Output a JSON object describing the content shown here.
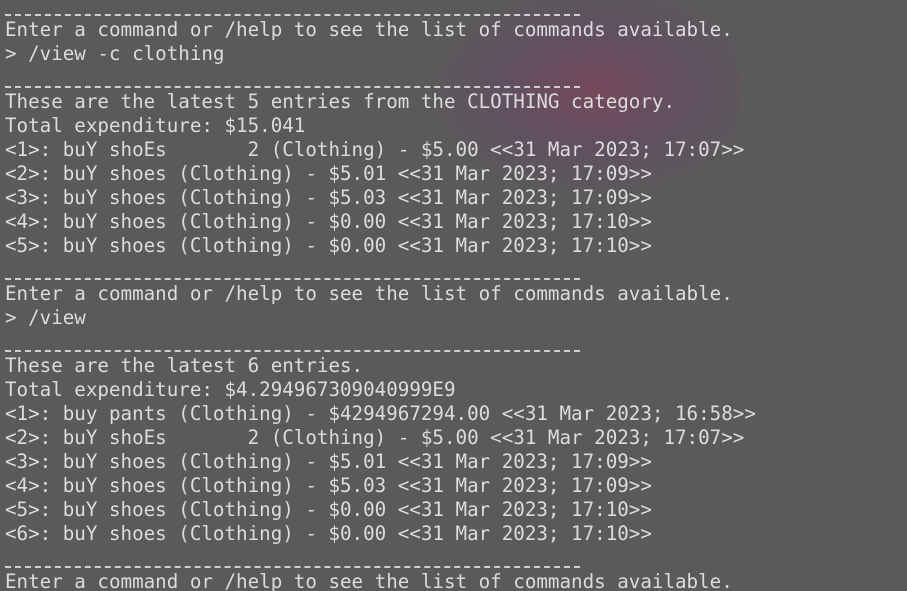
{
  "terminal": {
    "lines": [
      {
        "type": "sep"
      },
      {
        "type": "text",
        "text": "Enter a command or /help to see the list of commands available."
      },
      {
        "type": "text",
        "text": "> /view -c clothing"
      },
      {
        "type": "sep"
      },
      {
        "type": "text",
        "text": "These are the latest 5 entries from the CLOTHING category."
      },
      {
        "type": "text",
        "text": "Total expenditure: $15.041"
      },
      {
        "type": "text",
        "text": "<1>: buY shoEs       2 (Clothing) - $5.00 <<31 Mar 2023; 17:07>>"
      },
      {
        "type": "text",
        "text": "<2>: buY shoes (Clothing) - $5.01 <<31 Mar 2023; 17:09>>"
      },
      {
        "type": "text",
        "text": "<3>: buY shoes (Clothing) - $5.03 <<31 Mar 2023; 17:09>>"
      },
      {
        "type": "text",
        "text": "<4>: buY shoes (Clothing) - $0.00 <<31 Mar 2023; 17:10>>"
      },
      {
        "type": "text",
        "text": "<5>: buY shoes (Clothing) - $0.00 <<31 Mar 2023; 17:10>>"
      },
      {
        "type": "sep"
      },
      {
        "type": "text",
        "text": "Enter a command or /help to see the list of commands available."
      },
      {
        "type": "text",
        "text": "> /view"
      },
      {
        "type": "sep"
      },
      {
        "type": "text",
        "text": "These are the latest 6 entries."
      },
      {
        "type": "text",
        "text": "Total expenditure: $4.294967309040999E9"
      },
      {
        "type": "text",
        "text": "<1>: buy pants (Clothing) - $4294967294.00 <<31 Mar 2023; 16:58>>"
      },
      {
        "type": "text",
        "text": "<2>: buY shoEs       2 (Clothing) - $5.00 <<31 Mar 2023; 17:07>>"
      },
      {
        "type": "text",
        "text": "<3>: buY shoes (Clothing) - $5.01 <<31 Mar 2023; 17:09>>"
      },
      {
        "type": "text",
        "text": "<4>: buY shoes (Clothing) - $5.03 <<31 Mar 2023; 17:09>>"
      },
      {
        "type": "text",
        "text": "<5>: buY shoes (Clothing) - $0.00 <<31 Mar 2023; 17:10>>"
      },
      {
        "type": "text",
        "text": "<6>: buY shoes (Clothing) - $0.00 <<31 Mar 2023; 17:10>>"
      },
      {
        "type": "sep"
      },
      {
        "type": "text",
        "text": "Enter a command or /help to see the list of commands available."
      }
    ]
  }
}
